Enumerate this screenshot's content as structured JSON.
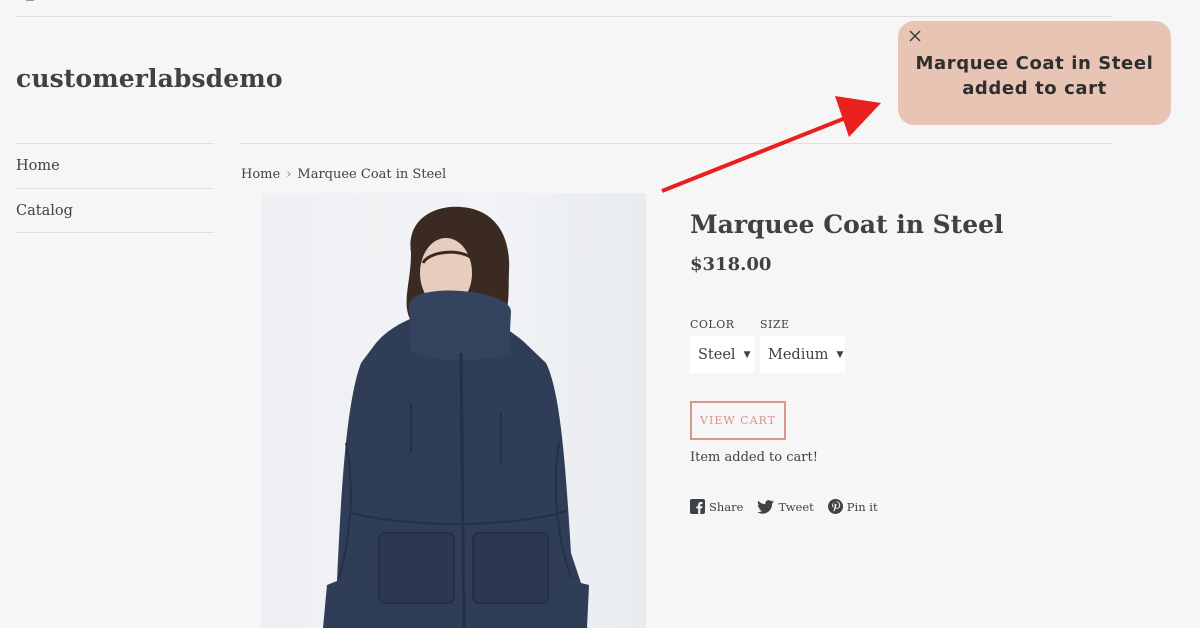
{
  "store": {
    "name": "customerlabsdemo"
  },
  "sidebar": {
    "items": [
      {
        "label": "Home"
      },
      {
        "label": "Catalog"
      }
    ]
  },
  "breadcrumb": {
    "home": "Home",
    "separator": "›",
    "current": "Marquee Coat in Steel"
  },
  "product": {
    "title": "Marquee Coat in Steel",
    "price": "$318.00",
    "options": {
      "color": {
        "label": "COLOR",
        "value": "Steel"
      },
      "size": {
        "label": "SIZE",
        "value": "Medium"
      }
    },
    "view_cart_label": "VIEW CART",
    "added_message": "Item added to cart!"
  },
  "social": {
    "share": "Share",
    "tweet": "Tweet",
    "pin": "Pin it"
  },
  "toast": {
    "line1": "Marquee Coat in Steel",
    "line2": "added to cart"
  },
  "colors": {
    "accent": "#d9958a",
    "toast_bg": "#e8c4b4",
    "arrow": "#e8201e",
    "text": "#3d4246"
  }
}
